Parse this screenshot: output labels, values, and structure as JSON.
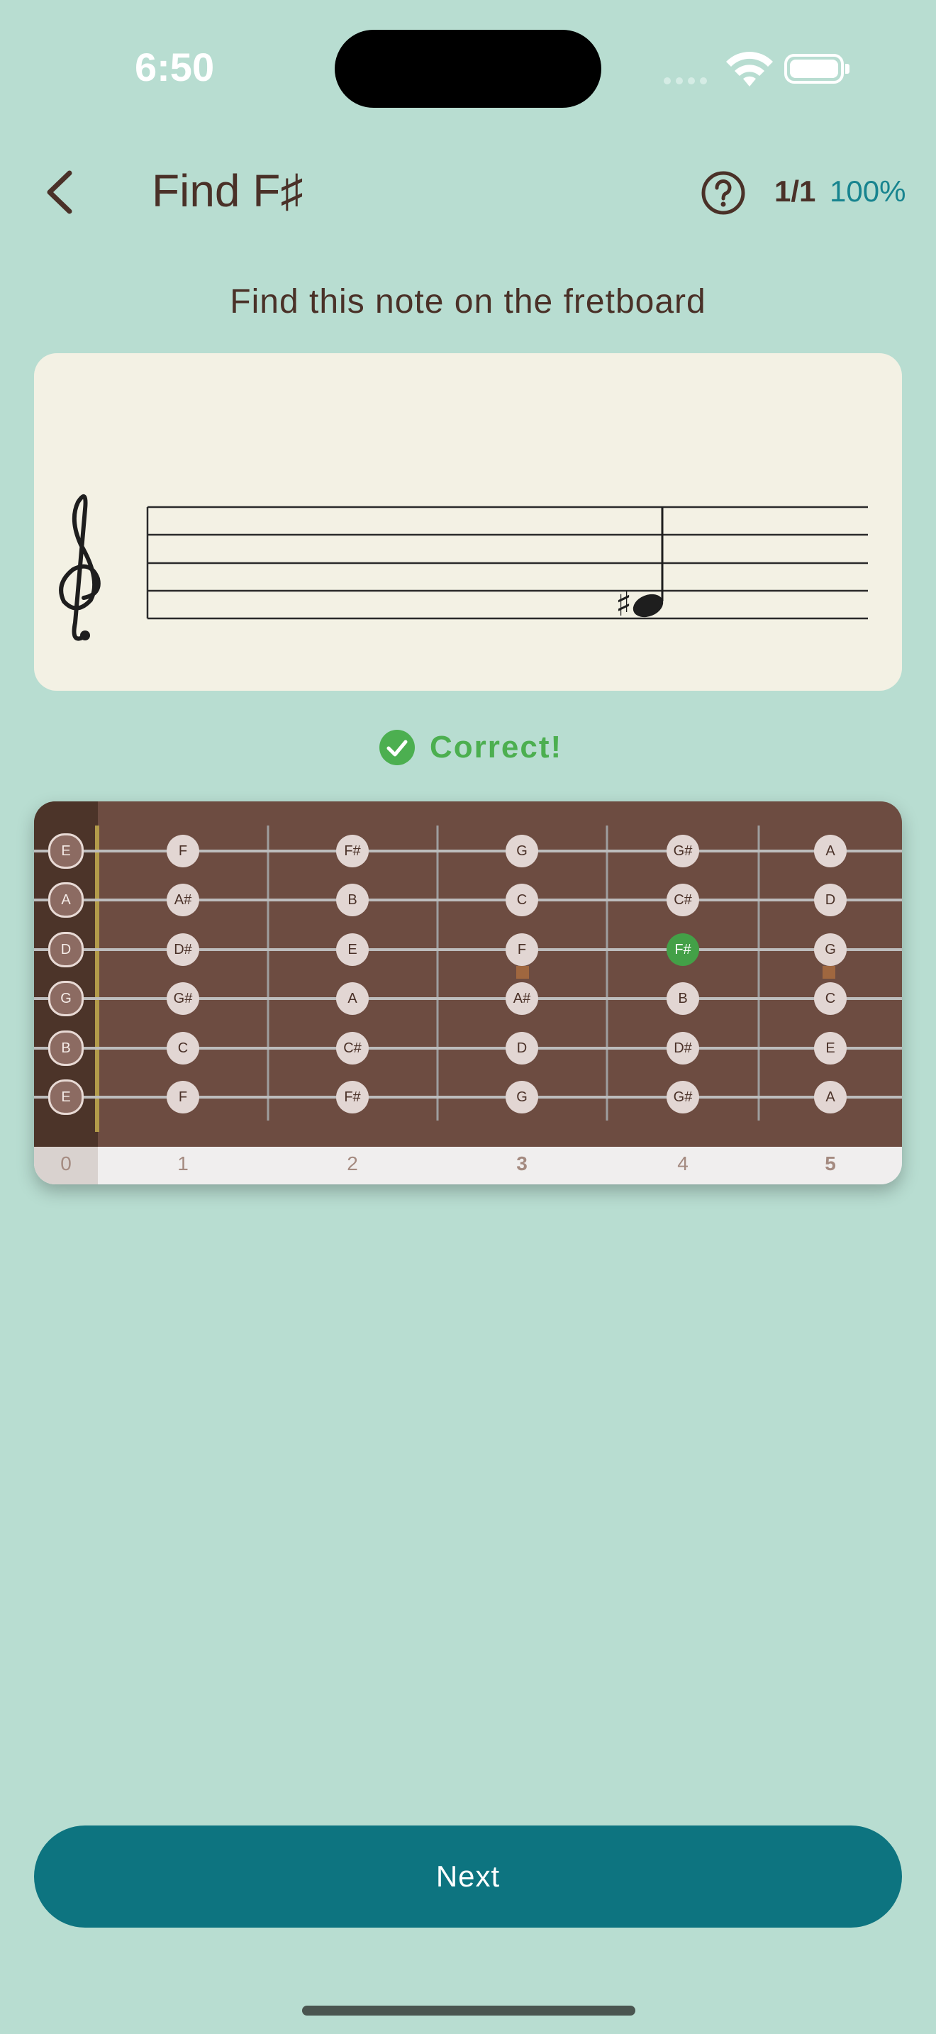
{
  "status": {
    "time": "6:50"
  },
  "header": {
    "title": "Find F♯",
    "score": "1/1",
    "percent": "100%"
  },
  "prompt": "Find this note on the fretboard",
  "staff": {
    "accidental": "♯"
  },
  "feedback": {
    "text": "Correct!",
    "color": "#4caf50"
  },
  "fretboard": {
    "open_notes": [
      "E",
      "A",
      "D",
      "G",
      "B",
      "E"
    ],
    "frets": [
      [
        "F",
        "A#",
        "D#",
        "G#",
        "C",
        "F"
      ],
      [
        "F#",
        "B",
        "E",
        "A",
        "C#",
        "F#"
      ],
      [
        "G",
        "C",
        "F",
        "A#",
        "D",
        "G"
      ],
      [
        "G#",
        "C#",
        "F#",
        "B",
        "D#",
        "G#"
      ],
      [
        "A",
        "D",
        "G",
        "C",
        "E",
        "A"
      ]
    ],
    "fret_numbers": [
      "0",
      "1",
      "2",
      "3",
      "4",
      "5"
    ],
    "correct_note": "F#"
  },
  "next_button": {
    "label": "Next"
  },
  "colors": {
    "background": "#b8ddd1",
    "accent": "#0d7480",
    "board": "#6d4c41"
  }
}
